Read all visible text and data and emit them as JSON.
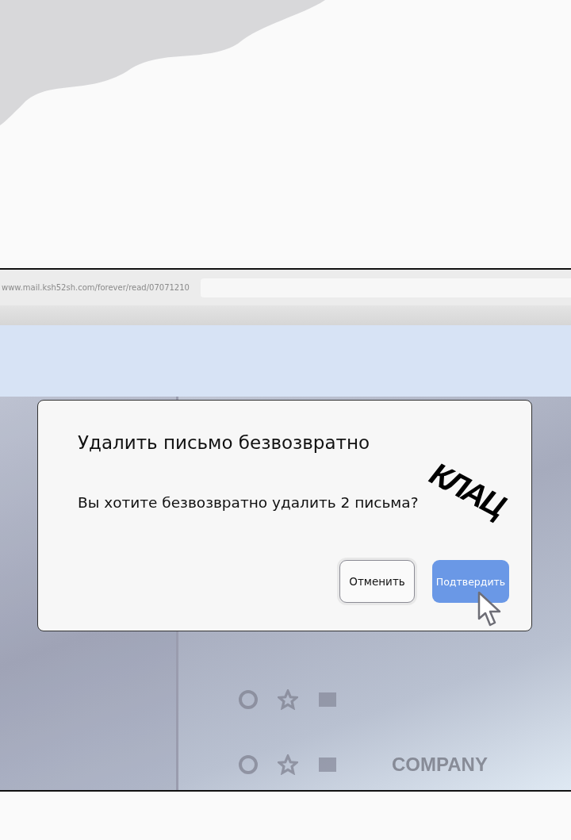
{
  "browser": {
    "url": "www.mail.ksh52sh.com/forever/read/07071210"
  },
  "dialog": {
    "title": "Удалить письмо безвозвратно",
    "message": "Вы хотите безвозвратно удалить 2 письма?",
    "buttons": [
      {
        "label": "Отменить",
        "kind": "secondary"
      },
      {
        "label": "Подтвердить",
        "kind": "primary"
      }
    ]
  },
  "sound_effect": "КЛАЦ",
  "mail_list": {
    "sender": "COMPANY"
  }
}
